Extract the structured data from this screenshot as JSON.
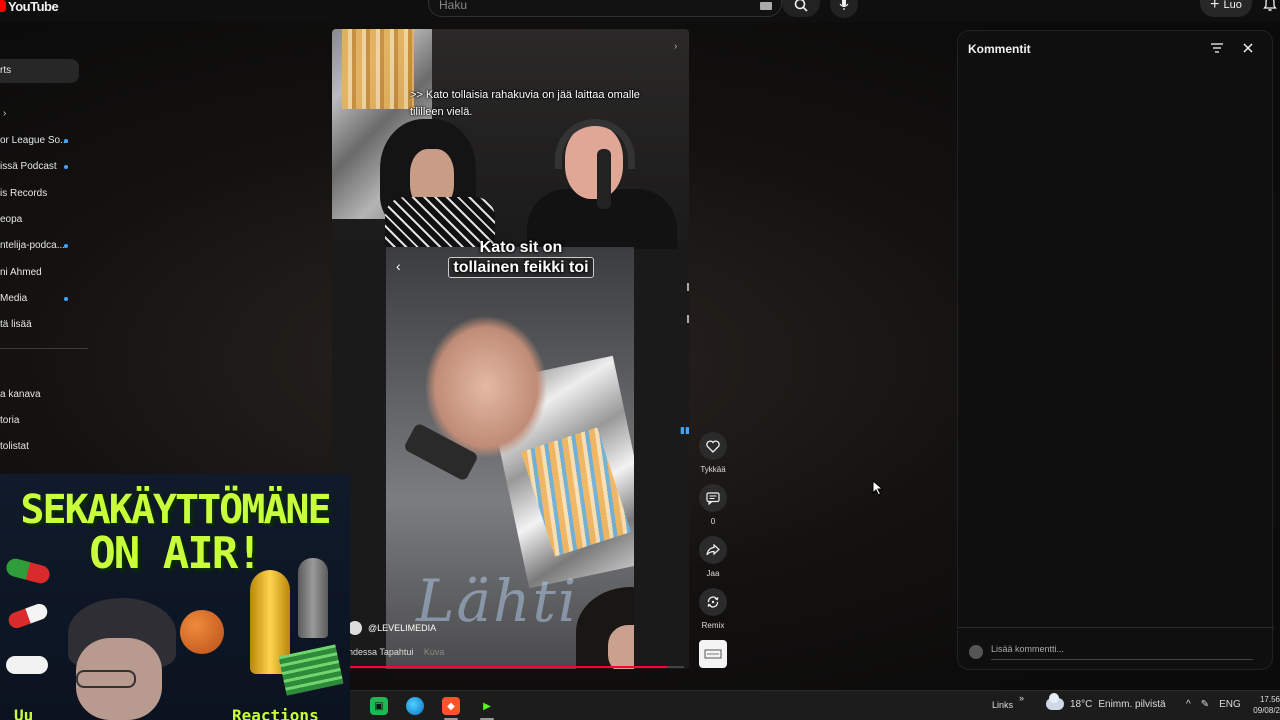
{
  "header": {
    "logo_text": "YouTube",
    "search_placeholder": "Haku",
    "create_label": "Luo"
  },
  "sidebar": {
    "active_item": "rts",
    "items": [
      {
        "label": "or League So...",
        "dot": true
      },
      {
        "label": "issä Podcast",
        "dot": true
      },
      {
        "label": "is Records",
        "dot": false
      },
      {
        "label": "eopa",
        "dot": false
      },
      {
        "label": "ntelija-podca...",
        "dot": true
      },
      {
        "label": "ni Ahmed",
        "dot": false
      },
      {
        "label": "Media",
        "dot": true
      },
      {
        "label": "tä lisää",
        "dot": false
      }
    ],
    "you_items": [
      "a kanava",
      "toria",
      "tolistat"
    ]
  },
  "video": {
    "caption_top": ">> Kato tollaisia rahakuvia on jää laittaa omalle tililleen vielä.",
    "caption_mid_line1": "Kato sit on",
    "caption_mid_line2": "tollainen feikki toi",
    "watermark": "Lähti",
    "channel_handle": "@LEVELIMEDIA",
    "event_text": "hdessa Tapahtui",
    "event_muted": "Kuva",
    "progress_fraction": 0.95
  },
  "actions": {
    "like_label": "Tykkää",
    "comment_count": "0",
    "share_label": "Jaa",
    "remix_label": "Remix"
  },
  "comments": {
    "title": "Kommentit",
    "input_placeholder": "Lisää kommentti..."
  },
  "overlay": {
    "line1": "SEKAKÄYTTÖMÄNE",
    "line2": "ON AIR!",
    "bottom_left": "Uu",
    "bottom_right": "Reactions"
  },
  "taskbar": {
    "links_label": "Links",
    "weather_temp": "18°C",
    "weather_desc": "Enimm. pilvistä",
    "language": "ENG",
    "time": "17.56",
    "date": "09/08/2"
  },
  "colors": {
    "accent_red": "#ff0000",
    "overlay_green": "#c8ff3a",
    "link_blue": "#3ea6ff"
  }
}
